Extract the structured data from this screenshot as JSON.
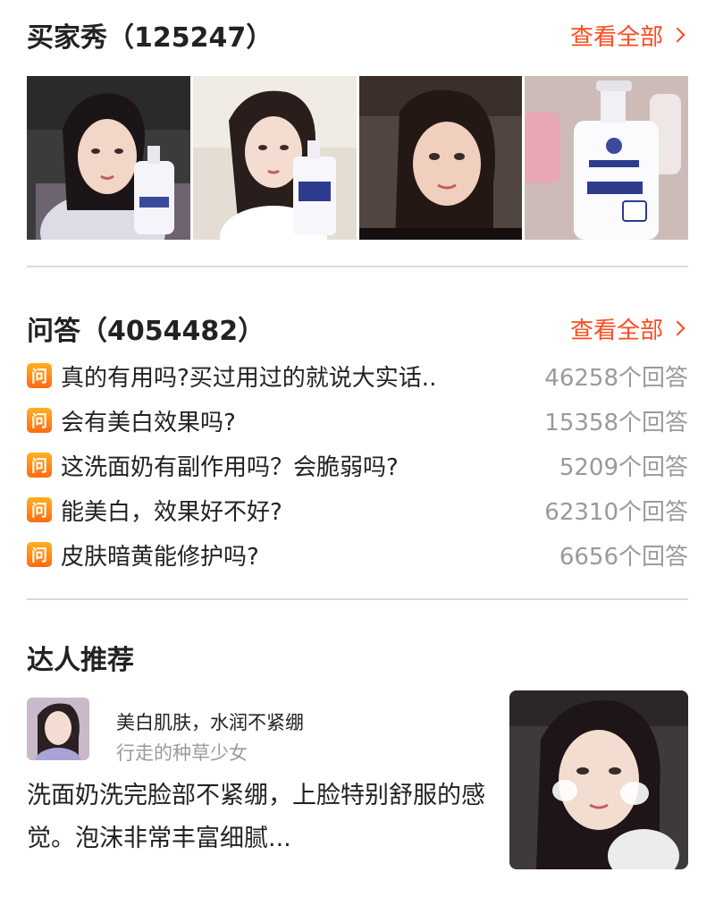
{
  "buyer_show": {
    "title": "买家秀（125247）",
    "view_all": "查看全部",
    "photos": [
      {
        "name": "buyer-photo-1"
      },
      {
        "name": "buyer-photo-2"
      },
      {
        "name": "buyer-photo-3"
      },
      {
        "name": "buyer-photo-4"
      }
    ]
  },
  "qa": {
    "title": "问答（4054482）",
    "view_all": "查看全部",
    "badge": "问",
    "items": [
      {
        "question": "真的有用吗?买过用过的就说大实话..",
        "answers": "46258个回答"
      },
      {
        "question": "会有美白效果吗?",
        "answers": "15358个回答"
      },
      {
        "question": "这洗面奶有副作用吗？会脆弱吗?",
        "answers": "5209个回答"
      },
      {
        "question": "能美白，效果好不好?",
        "answers": "62310个回答"
      },
      {
        "question": "皮肤暗黄能修护吗?",
        "answers": "6656个回答"
      }
    ]
  },
  "expert": {
    "title": "达人推荐",
    "post_title": "美白肌肤，水润不紧绷",
    "author": "行走的种草少女",
    "description": "洗面奶洗完脸部不紧绷，上脸特别舒服的感觉。泡沫非常丰富细腻..."
  },
  "colors": {
    "accent": "#ff4a1f",
    "muted": "#9a9a9a",
    "divider": "#d9d9d9"
  }
}
